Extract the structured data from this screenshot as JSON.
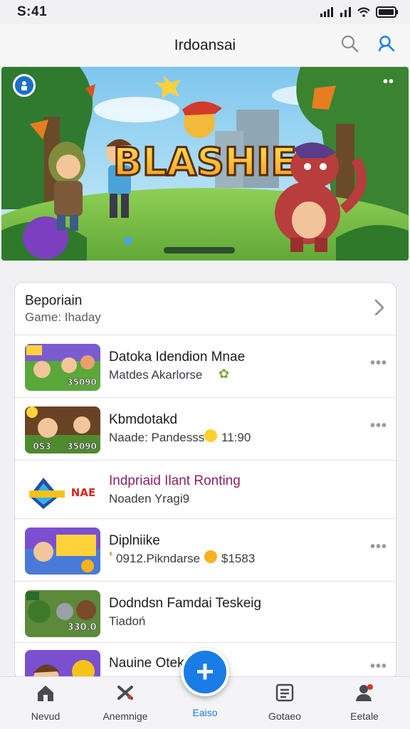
{
  "status_bar": {
    "time": "S:41"
  },
  "header": {
    "title": "Irdoansai"
  },
  "banner": {
    "logo_text": "BLASHIE",
    "slide_count": 1
  },
  "section": {
    "title": "Beporiain",
    "subtitle": "Game: Ihaday",
    "items": [
      {
        "name": "Datoka Idendion Mnae",
        "meta": "Matdes Akarlorse",
        "thumb_label_1": "",
        "thumb_label_2": "35090"
      },
      {
        "name": "Kbmdotakd",
        "meta": "Naade: Pandesss",
        "meta_extra": "11:90",
        "thumb_label_1": "0S3",
        "thumb_label_2": "35090"
      },
      {
        "name": "Indpriaid Ilant Ronting",
        "meta": "Noaden Yragi9",
        "thumb_label_1": "NAE",
        "thumb_label_2": ""
      },
      {
        "name": "Diplniike",
        "meta": "0912.Pikndarse",
        "meta_extra": "$1583",
        "thumb_label_1": "",
        "thumb_label_2": ""
      },
      {
        "name": "Dodndsn Famdai Teskeig",
        "meta": "Tiadoń",
        "thumb_label_1": "",
        "thumb_label_2": "330.0"
      },
      {
        "name": "Nauine Otek",
        "meta": "",
        "thumb_label_1": "",
        "thumb_label_2": ""
      }
    ]
  },
  "fab": {
    "label": "+"
  },
  "tabs": [
    {
      "label": "Nevud",
      "icon": "home-icon"
    },
    {
      "label": "Anemnige",
      "icon": "games-icon"
    },
    {
      "label": "Eaiso",
      "icon": "add-icon"
    },
    {
      "label": "Gotaeo",
      "icon": "news-icon"
    },
    {
      "label": "Eetale",
      "icon": "profile-icon"
    }
  ],
  "colors": {
    "accent": "#1a7ce6",
    "name_highlight": "#8b1f6b"
  }
}
